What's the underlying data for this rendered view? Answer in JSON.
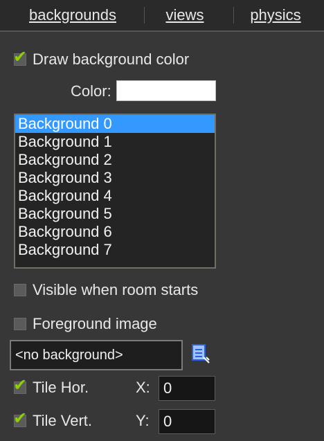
{
  "tabs": [
    {
      "label": "backgrounds"
    },
    {
      "label": "views"
    },
    {
      "label": "physics"
    }
  ],
  "draw_bg_color": {
    "label": "Draw background color",
    "checked": true
  },
  "color": {
    "label": "Color:",
    "value_hex": "#ffffff"
  },
  "backgrounds": {
    "items": [
      "Background 0",
      "Background 1",
      "Background 2",
      "Background 3",
      "Background 4",
      "Background 5",
      "Background 6",
      "Background 7"
    ],
    "selected_index": 0
  },
  "visible_when_room_starts": {
    "label": "Visible when room starts",
    "checked": false
  },
  "foreground_image": {
    "label": "Foreground image",
    "checked": false
  },
  "background_select": {
    "value": "<no background>"
  },
  "tile_hor": {
    "label": "Tile Hor.",
    "checked": true
  },
  "tile_vert": {
    "label": "Tile Vert.",
    "checked": true
  },
  "x": {
    "label": "X:",
    "value": "0"
  },
  "y": {
    "label": "Y:",
    "value": "0"
  },
  "colors": {
    "accent_check": "#8fd000",
    "selection": "#3399ff"
  }
}
